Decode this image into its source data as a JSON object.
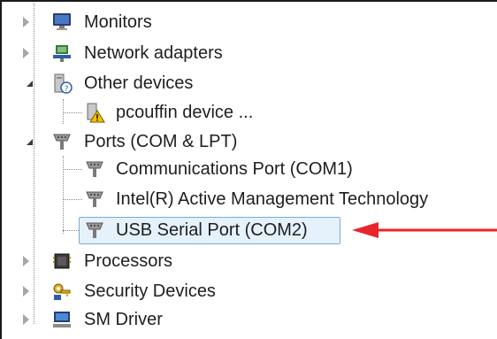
{
  "tree": {
    "items": [
      {
        "label": "Monitors",
        "icon": "monitor-icon"
      },
      {
        "label": "Network adapters",
        "icon": "network-adapter-icon"
      },
      {
        "label": "Other devices",
        "icon": "unknown-device-icon"
      },
      {
        "label": "pcouffin device ...",
        "icon": "warning-device-icon"
      },
      {
        "label": "Ports (COM & LPT)",
        "icon": "port-icon"
      },
      {
        "label": "Communications Port (COM1)",
        "icon": "port-icon"
      },
      {
        "label": "Intel(R) Active Management Technology",
        "icon": "port-icon"
      },
      {
        "label": "USB Serial Port (COM2)",
        "icon": "port-icon"
      },
      {
        "label": "Processors",
        "icon": "processor-icon"
      },
      {
        "label": "Security Devices",
        "icon": "security-key-icon"
      },
      {
        "label": "SM Driver",
        "icon": "computer-icon"
      }
    ]
  },
  "colors": {
    "selection_border": "#7fa8d8",
    "selection_fill": "#e5f1fb",
    "arrow": "#e8262a"
  }
}
